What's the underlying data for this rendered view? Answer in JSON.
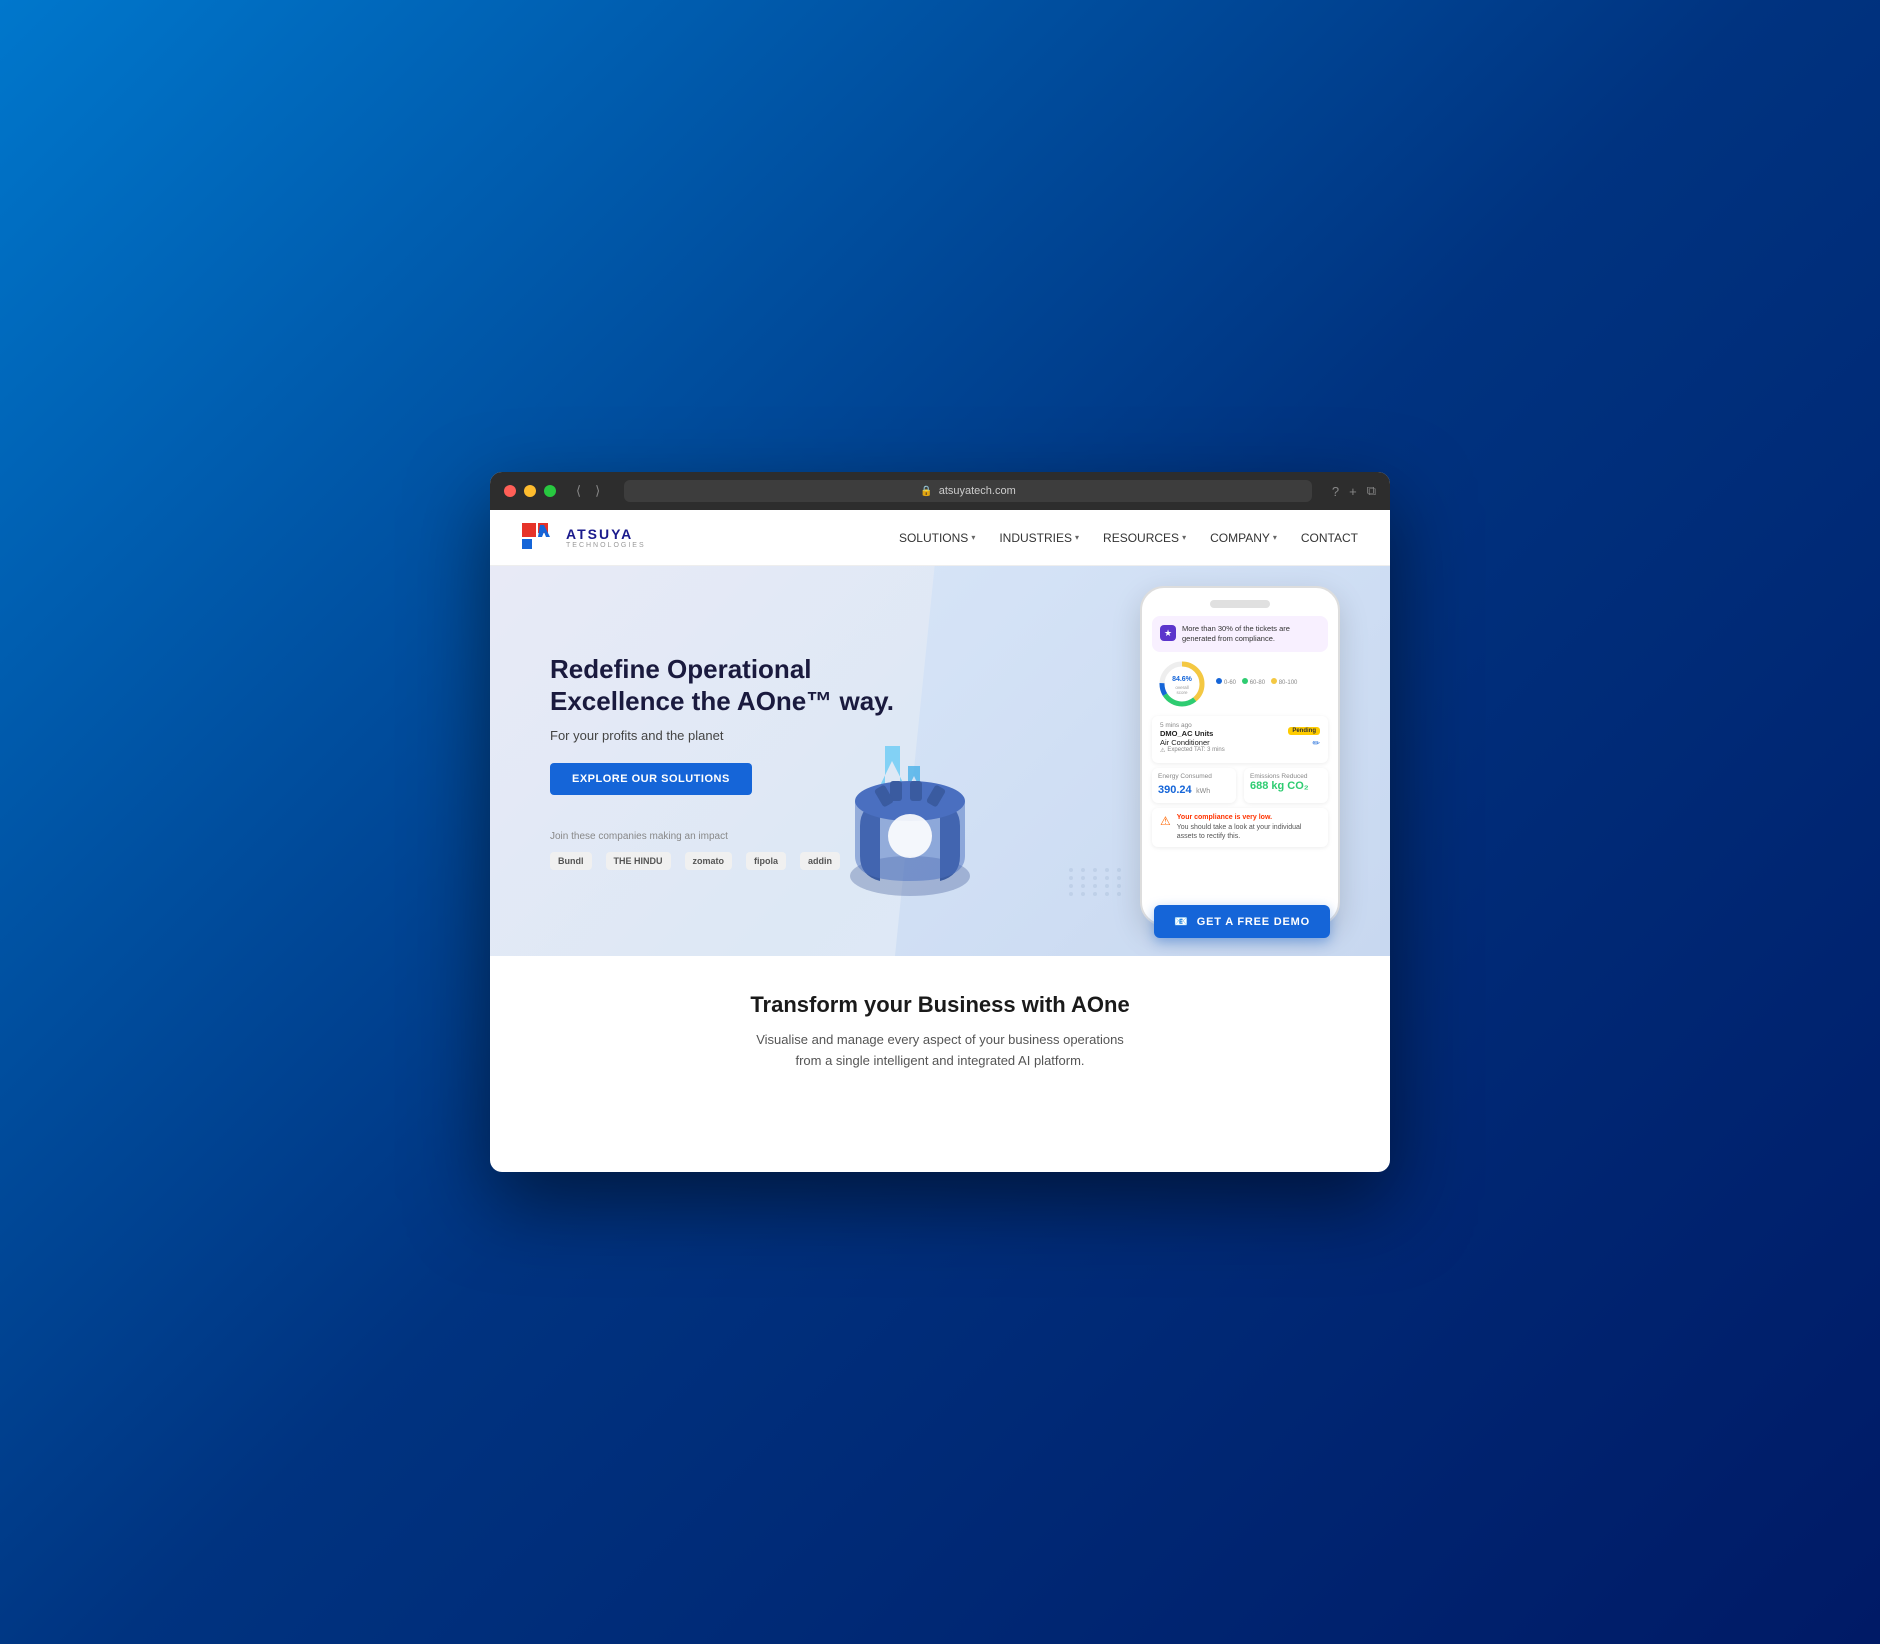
{
  "browser": {
    "url": "atsuyatech.com",
    "tab_text": "atsuyatech.com"
  },
  "navbar": {
    "logo_name": "ATSUYA",
    "logo_sub": "TECHNOLOGIES",
    "nav_items": [
      {
        "label": "SOLUTIONS",
        "has_chevron": true
      },
      {
        "label": "INDUSTRIES",
        "has_chevron": true
      },
      {
        "label": "RESOURCES",
        "has_chevron": true
      },
      {
        "label": "COMPANY",
        "has_chevron": true
      },
      {
        "label": "CONTACT",
        "has_chevron": false
      }
    ]
  },
  "hero": {
    "title": "Redefine Operational Excellence the AOne™ way.",
    "subtitle": "For your profits and the planet",
    "cta_label": "EXPLORE OUR SOLUTIONS",
    "companies_label": "Join these companies making an impact",
    "company_logos": [
      "Bundl",
      "THE HINDU",
      "zomato",
      "fipola",
      "addin"
    ]
  },
  "phone": {
    "compliance_banner": "More than 30% of the tickets are generated from compliance.",
    "gauge_value": "84.6%",
    "gauge_label": "overall score",
    "legend": [
      "0-60",
      "60-80",
      "80-100"
    ],
    "ticket_time": "5 mins ago",
    "ticket_badge": "Pending",
    "ticket_title": "DMO_AC Units",
    "ticket_subtitle": "Air Conditioner",
    "ticket_tat": "Expected TAT: 3 mins",
    "energy_label": "Energy Consumed",
    "energy_value": "390.24",
    "energy_unit": "kWh",
    "emissions_label": "Emissions Reduced",
    "emissions_value": "688 kg CO₂",
    "compliance_title": "Your compliance is very low.",
    "compliance_desc": "You should take a look at your individual assets to rectify this."
  },
  "demo_button": {
    "label": "GET A FREE DEMO"
  },
  "transform_section": {
    "title": "Transform your Business with AOne",
    "desc_line1": "Visualise and manage every aspect of your business operations",
    "desc_line2": "from a single intelligent and integrated AI platform."
  }
}
